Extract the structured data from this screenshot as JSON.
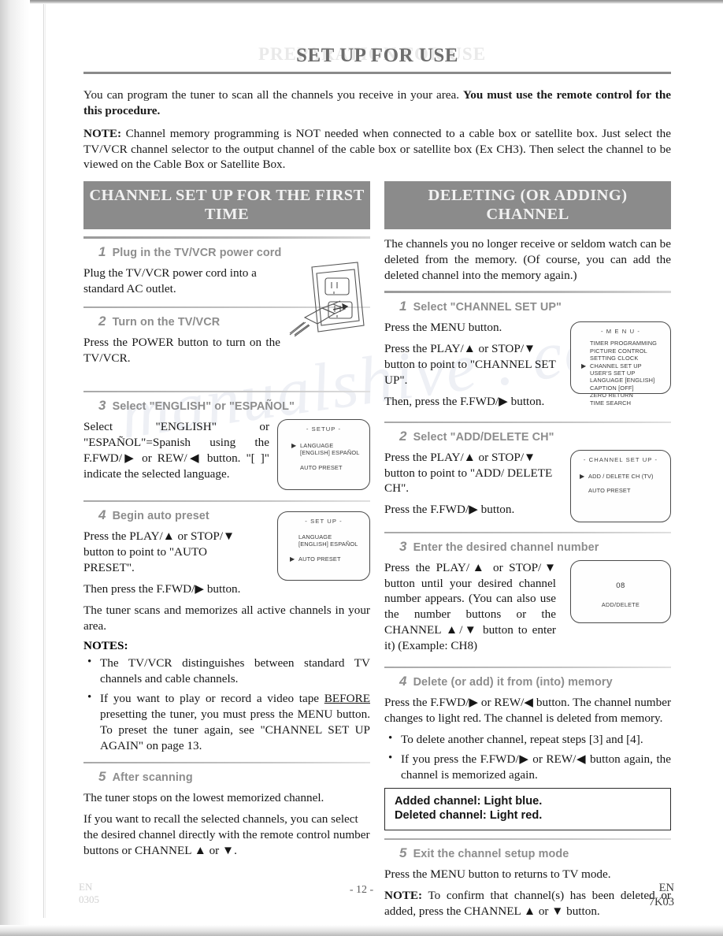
{
  "document": {
    "title": "SET UP FOR USE",
    "ghost_title": "PREPARATION FOR USE",
    "watermark": "manualshive . com"
  },
  "intro": {
    "p1_plain": "You can program the tuner to scan all the channels you receive in your area. ",
    "p1_bold": "You must use the remote control for the this procedure.",
    "note_label": "NOTE:",
    "note_text": " Channel memory programming is NOT needed when connected to a cable box or satellite box. Just select the TV/VCR channel selector to the output channel of the cable box or satellite box (Ex CH3). Then select the channel to be viewed on the Cable Box or Satellite Box."
  },
  "left_column": {
    "header": "CHANNEL SET UP FOR THE FIRST TIME",
    "steps": [
      {
        "num": "1",
        "title": "Plug in the TV/VCR power cord",
        "body": "Plug the TV/VCR power cord into a standard AC outlet."
      },
      {
        "num": "2",
        "title": "Turn on the TV/VCR",
        "body": "Press the POWER button to turn on the TV/VCR."
      },
      {
        "num": "3",
        "title": "Select \"ENGLISH\" or \"ESPAÑOL\"",
        "body": "Select \"ENGLISH\" or \"ESPAÑOL\"=Spanish using the F.FWD/▶ or REW/◀ button. \"[ ]\" indicate the selected language."
      },
      {
        "num": "4",
        "title": "Begin auto preset",
        "body1": "Press the PLAY/▲ or STOP/▼ button to point to \"AUTO PRESET\".",
        "body2": "Then press the F.FWD/▶ button.",
        "body3": "The tuner scans and memorizes all active channels in your area.",
        "notes_label": "NOTES:",
        "notes": [
          "The TV/VCR distinguishes between standard TV channels and cable channels.",
          "If you want to play or record a video tape BEFORE presetting the tuner, you must press the MENU button. To preset the tuner again, see \"CHANNEL SET UP AGAIN\" on page 13."
        ],
        "note2_pre": "If you want to play or record a video tape ",
        "note2_underline": "BEFORE",
        "note2_post": " presetting the tuner, you must press the MENU button. To preset the tuner again, see \"CHANNEL SET UP AGAIN\" on page 13."
      },
      {
        "num": "5",
        "title": "After scanning",
        "body1": "The tuner stops on the lowest memorized channel.",
        "body2": "If you want to recall the selected channels, you can select the desired channel directly with the remote control number buttons or CHANNEL ▲ or ▼."
      }
    ],
    "osd_setup_language": {
      "title": "- SETUP -",
      "rows": [
        {
          "text": "LANGUAGE",
          "cursor": true
        },
        {
          "text": "[ENGLISH]     ESPAÑOL",
          "cursor": false
        },
        {
          "text": "AUTO PRESET",
          "cursor": false
        }
      ]
    },
    "osd_setup_autopreset": {
      "title": "- SET UP -",
      "rows": [
        {
          "text": "LANGUAGE",
          "cursor": false
        },
        {
          "text": "[ENGLISH]     ESPAÑOL",
          "cursor": false
        },
        {
          "text": "AUTO PRESET",
          "cursor": true
        }
      ]
    }
  },
  "right_column": {
    "header": "DELETING (OR ADDING) CHANNEL",
    "intro": "The channels you no longer receive or seldom watch can be deleted from the memory. (Of course, you can add the deleted channel into the memory again.)",
    "steps": [
      {
        "num": "1",
        "title": "Select \"CHANNEL SET UP\"",
        "body1": "Press the MENU button.",
        "body2": "Press the PLAY/▲ or STOP/▼ button to point to \"CHANNEL SET UP\".",
        "body3": "Then, press the F.FWD/▶ button."
      },
      {
        "num": "2",
        "title": "Select \"ADD/DELETE CH\"",
        "body1": "Press the PLAY/▲ or STOP/▼ button to point to \"ADD/ DELETE CH\".",
        "body2": "Press the F.FWD/▶ button."
      },
      {
        "num": "3",
        "title": "Enter the desired channel number",
        "body1": "Press the PLAY/▲ or STOP/▼ button until your desired channel number appears. (You can also use the number buttons  or the CHANNEL ▲/▼ button to enter it) (Example: CH8)"
      },
      {
        "num": "4",
        "title": "Delete (or add) it from (into) memory",
        "body1": "Press the F.FWD/▶ or REW/◀ button. The channel number changes to light red. The channel is deleted from memory.",
        "bullets": [
          "To delete another channel, repeat steps [3] and [4].",
          "If you press the F.FWD/▶ or REW/◀ button again, the channel is memorized again."
        ]
      },
      {
        "num": "5",
        "title": "Exit the channel setup mode",
        "body1": "Press the MENU button to returns to TV mode.",
        "note_label": "NOTE:",
        "note_text": " To confirm that channel(s) has been deleted or added, press the CHANNEL ▲ or ▼ button."
      }
    ],
    "callout": {
      "line1": "Added channel: Light blue.",
      "line2": "Deleted channel: Light red."
    },
    "osd_menu": {
      "title": "- M E N U -",
      "rows": [
        {
          "text": "TIMER PROGRAMMING",
          "cursor": false
        },
        {
          "text": "PICTURE CONTROL",
          "cursor": false
        },
        {
          "text": "SETTING CLOCK",
          "cursor": false
        },
        {
          "text": "CHANNEL SET UP",
          "cursor": true
        },
        {
          "text": "USER'S SET UP",
          "cursor": false
        },
        {
          "text": "LANGUAGE  [ENGLISH]",
          "cursor": false
        },
        {
          "text": "CAPTION  [OFF]",
          "cursor": false
        },
        {
          "text": "ZERO RETURN",
          "cursor": false
        },
        {
          "text": "TIME SEARCH",
          "cursor": false
        }
      ]
    },
    "osd_channel_setup": {
      "title": "- CHANNEL SET UP -",
      "rows": [
        {
          "text": "ADD / DELETE CH (TV)",
          "cursor": true
        },
        {
          "text": "AUTO PRESET",
          "cursor": false
        }
      ]
    },
    "osd_add_delete": {
      "channel": "08",
      "label": "ADD/DELETE"
    }
  },
  "footer": {
    "page_number": "- 12 -",
    "region": "EN",
    "code": "7K03"
  }
}
